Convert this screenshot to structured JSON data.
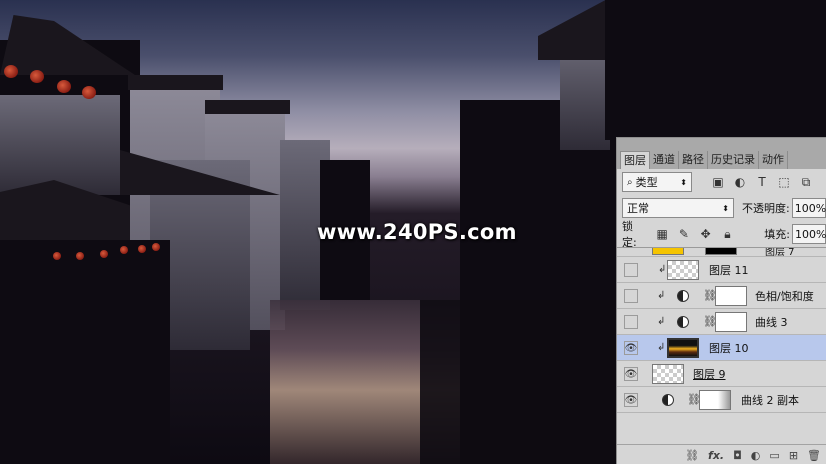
{
  "watermark": "www.240PS.com",
  "panel": {
    "tabs": [
      "图层",
      "通道",
      "路径",
      "历史记录",
      "动作"
    ],
    "active_tab": "图层",
    "filter_label": "类型",
    "blend_mode": "正常",
    "opacity_label": "不透明度:",
    "opacity_value": "100%",
    "lock_label": "锁定:",
    "fill_label": "填充:",
    "fill_value": "100%",
    "layers": [
      {
        "name": "图层 7",
        "visible": false
      },
      {
        "name": "图层 11",
        "visible": false
      },
      {
        "name": "色相/饱和度",
        "visible": false
      },
      {
        "name": "曲线 3",
        "visible": false
      },
      {
        "name": "图层 10",
        "visible": true,
        "selected": true
      },
      {
        "name": "图层 9",
        "visible": true
      },
      {
        "name": "曲线 2 副本",
        "visible": true
      }
    ]
  },
  "colors": {
    "selected_row": "#b8c8ec",
    "panel_bg": "#d6d6d6",
    "layer7_thumb": "#f5c400"
  }
}
